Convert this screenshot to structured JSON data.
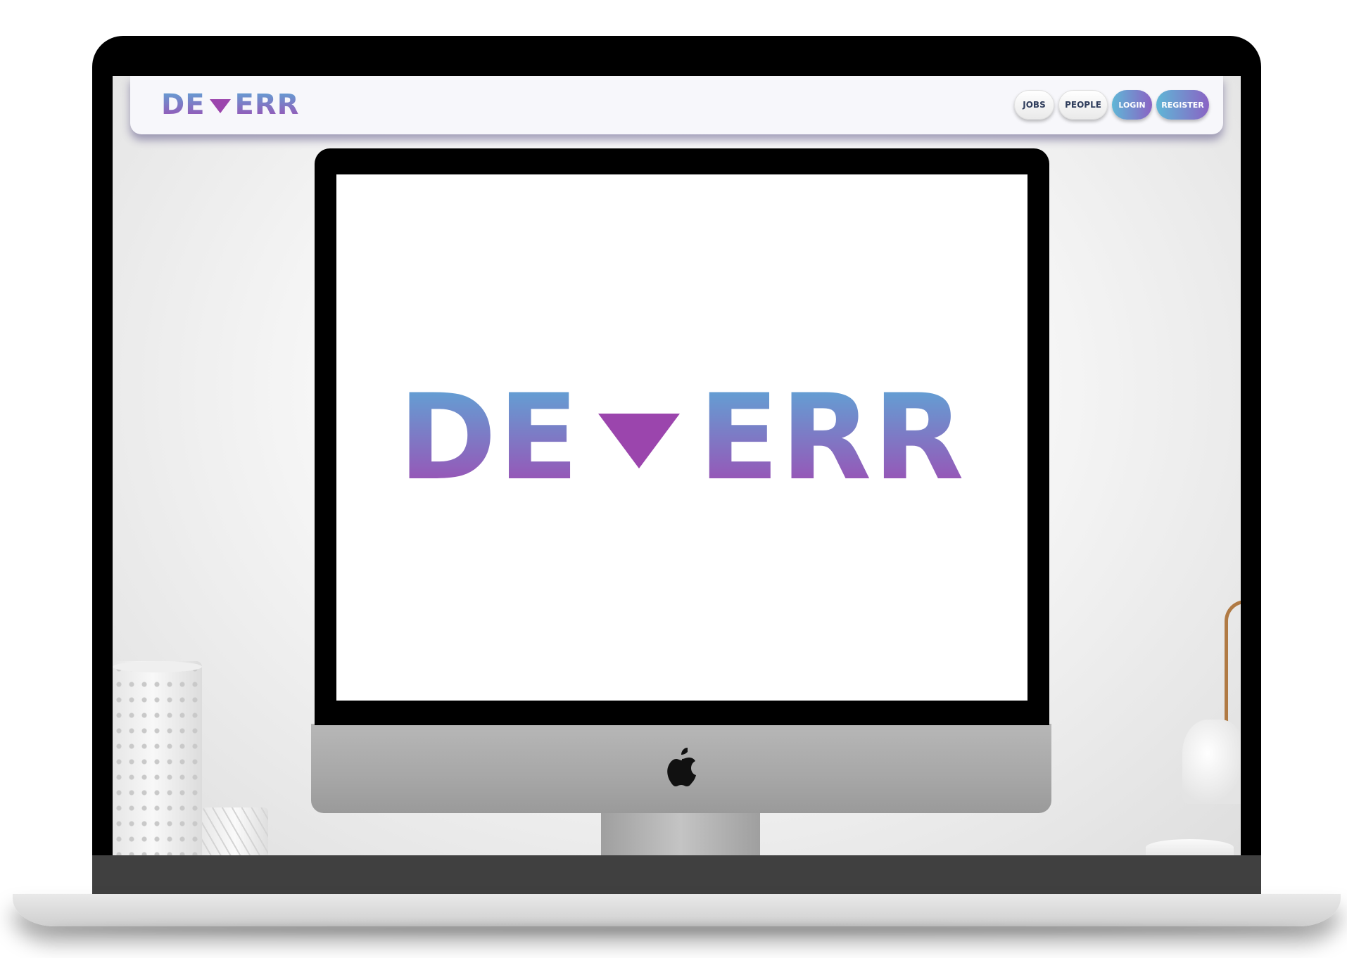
{
  "app": {
    "logo_left": "DE",
    "logo_right": "ERR",
    "logo_icon": "down-triangle-icon"
  },
  "nav": {
    "jobs": "JOBS",
    "people": "PEOPLE",
    "login": "LOGIN",
    "register": "REGISTER"
  },
  "hero": {
    "logo_left": "DE",
    "logo_right": "ERR",
    "logo_icon": "down-triangle-icon",
    "device_icon": "apple-icon"
  },
  "colors": {
    "brand_gradient_top": "#5ea6d6",
    "brand_gradient_bottom": "#9e4cb3",
    "triangle": "#9b45ad",
    "button_gradient_start": "#5fb7d6",
    "button_gradient_end": "#8a63c4",
    "navbar_bg": "#f7f7fb"
  }
}
